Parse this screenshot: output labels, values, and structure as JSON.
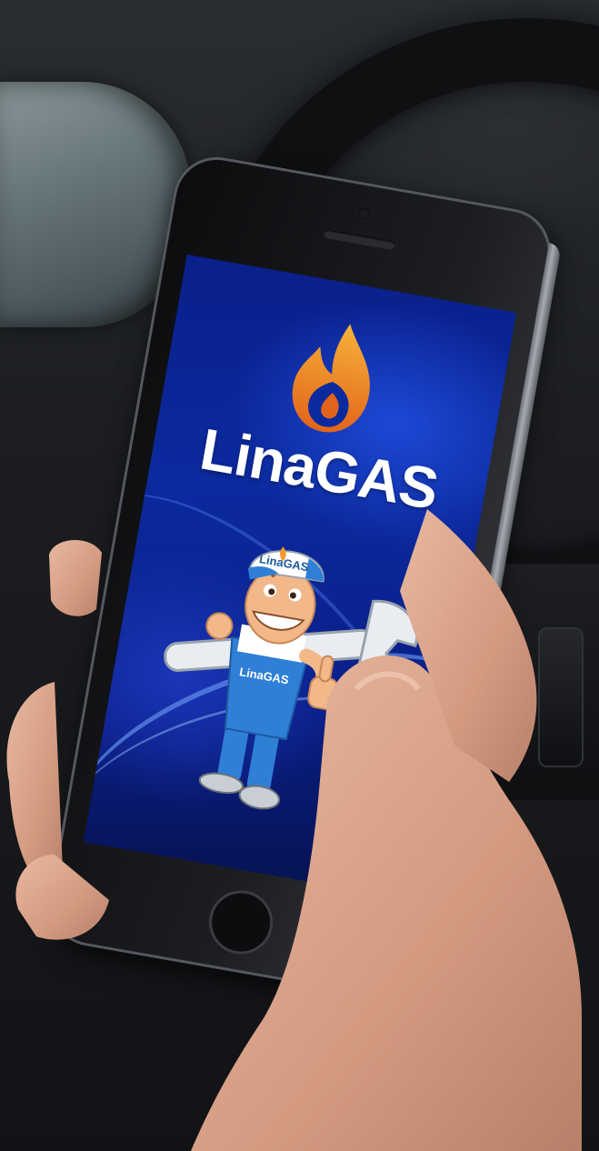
{
  "app": {
    "brand_name": "LinaGAS",
    "mascot_cap_text": "LinaGAS",
    "mascot_overall_text": "LinaGAS"
  },
  "colors": {
    "screen_background": "#0b2a9e",
    "flame_outer": "#f39a2a",
    "flame_inner": "#d85a12",
    "brand_text": "#ffffff",
    "mascot_uniform": "#2f7fd6"
  },
  "icons": {
    "logo": "flame-icon",
    "mascot": "mechanic-mascot-with-wrench"
  }
}
